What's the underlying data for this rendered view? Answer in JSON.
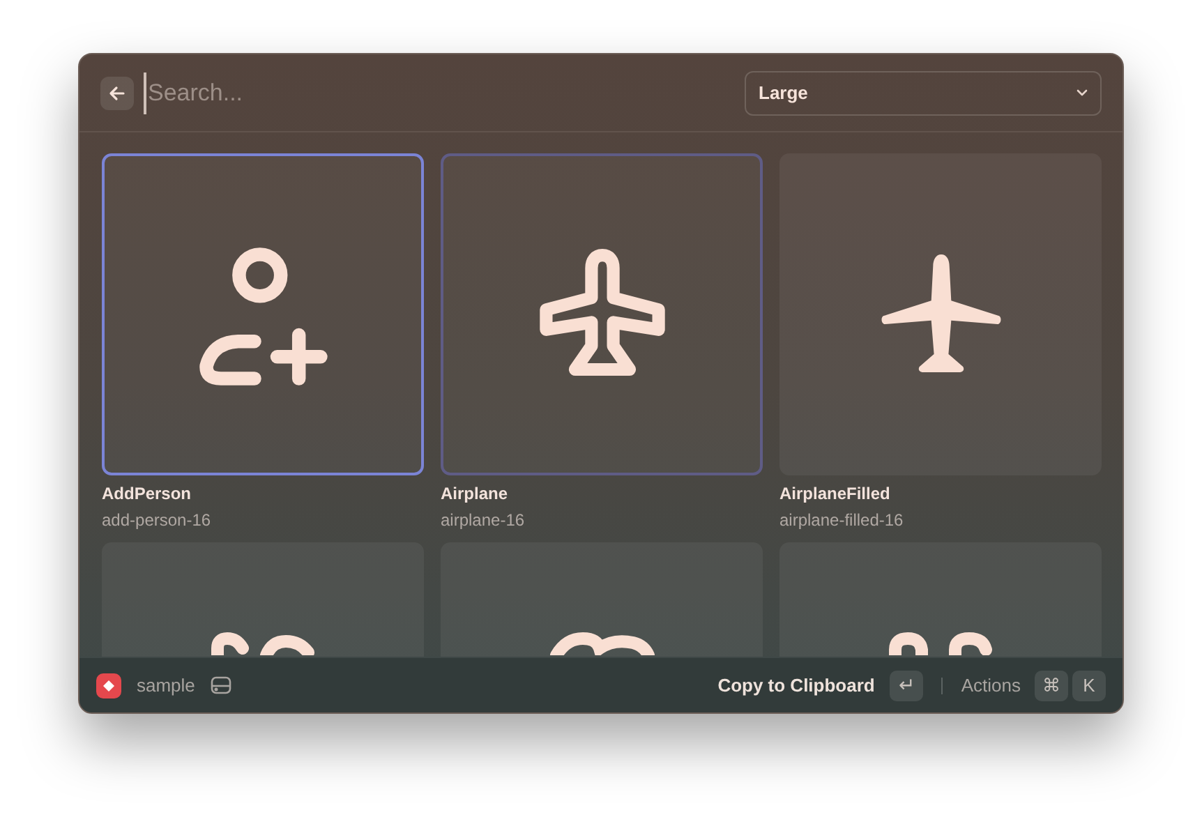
{
  "search": {
    "placeholder": "Search..."
  },
  "size_dropdown": {
    "value": "Large"
  },
  "items": [
    {
      "name": "AddPerson",
      "slug": "add-person-16",
      "selected": true,
      "hovered": false
    },
    {
      "name": "Airplane",
      "slug": "airplane-16",
      "selected": false,
      "hovered": true
    },
    {
      "name": "AirplaneFilled",
      "slug": "airplane-filled-16",
      "selected": false,
      "hovered": false
    },
    {
      "selected": false,
      "hovered": false
    },
    {
      "selected": false,
      "hovered": false
    },
    {
      "selected": false,
      "hovered": false
    }
  ],
  "footer": {
    "extension": "sample",
    "primary_action": "Copy to Clipboard",
    "primary_key": "↵",
    "actions_label": "Actions",
    "action_keys": [
      "⌘",
      "K"
    ]
  }
}
